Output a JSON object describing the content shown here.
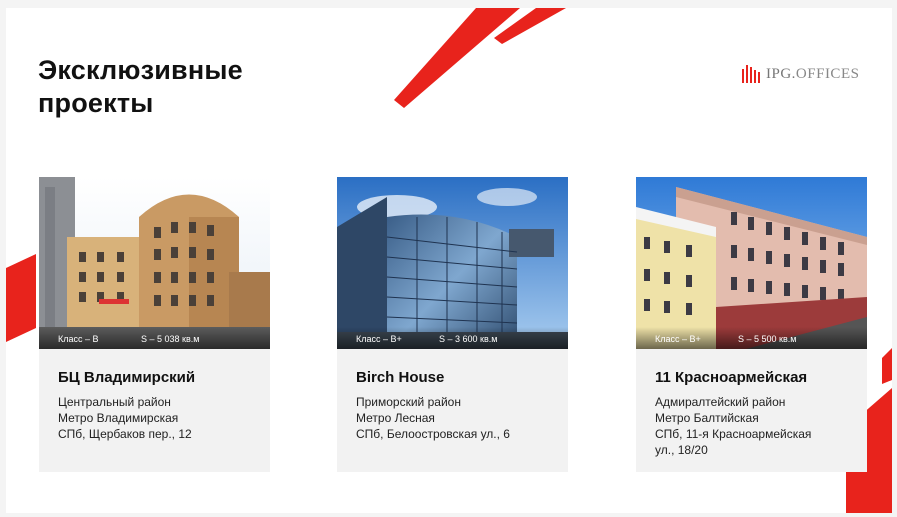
{
  "title_line1": "Эксклюзивные",
  "title_line2": "проекты",
  "logo": {
    "icon": "bars-logo-icon",
    "text_a": "IPG.",
    "text_b": "OFFICES"
  },
  "colors": {
    "accent": "#e8231c",
    "background": "#ffffff",
    "card": "#f2f2f2"
  },
  "cards": [
    {
      "class_label": "Класс – B",
      "area_label": "S – 5 038 кв.м",
      "name": "БЦ Владимирский",
      "district": "Центральный район",
      "metro": "Метро Владимирская",
      "address": "СПб, Щербаков пер., 12",
      "address2": ""
    },
    {
      "class_label": "Класс – B+",
      "area_label": "S – 3 600 кв.м",
      "name": "Birch House",
      "district": "Приморский район",
      "metro": "Метро Лесная",
      "address": "СПб, Белоостровская ул., 6",
      "address2": ""
    },
    {
      "class_label": "Класс – B+",
      "area_label": "S – 5 500 кв.м",
      "name": "11 Красноармейская",
      "district": "Адмиралтейский район",
      "metro": "Метро Балтийская",
      "address": "СПб, 11-я Красноармейская",
      "address2": "ул., 18/20"
    }
  ]
}
